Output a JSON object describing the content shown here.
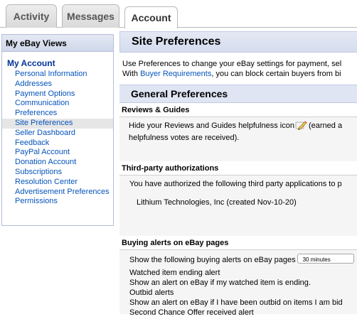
{
  "tabs": [
    {
      "label": "Activity"
    },
    {
      "label": "Messages"
    },
    {
      "label": "Account"
    }
  ],
  "sidebar": {
    "title": "My eBay Views",
    "section": "My Account",
    "items": [
      {
        "label": "Personal Information"
      },
      {
        "label": "Addresses"
      },
      {
        "label": "Payment Options"
      },
      {
        "label": "Communication Preferences"
      },
      {
        "label": "Site Preferences"
      },
      {
        "label": "Seller Dashboard"
      },
      {
        "label": "Feedback"
      },
      {
        "label": "PayPal Account"
      },
      {
        "label": "Donation Account"
      },
      {
        "label": "Subscriptions"
      },
      {
        "label": "Resolution Center"
      },
      {
        "label": "Advertisement Preferences"
      },
      {
        "label": "Permissions"
      }
    ]
  },
  "main": {
    "title": "Site Preferences",
    "intro_line1": "Use Preferences to change your eBay settings for payment, sel",
    "intro_line2_prefix": "With ",
    "intro_link": "Buyer Requirements",
    "intro_line2_suffix": ", you can block certain buyers from bi",
    "general_header": "General Preferences",
    "reviews": {
      "title": "Reviews & Guides",
      "text_before_icon": "Hide your Reviews and Guides helpfulness icon",
      "text_after_icon": "(earned a",
      "line2": "helpfulness votes are received)."
    },
    "third_party": {
      "title": "Third-party authorizations",
      "intro": "You have authorized the following third party applications to p",
      "app": "Lithium Technologies, Inc (created Nov-10-20)"
    },
    "buying_alerts": {
      "title": "Buying alerts on eBay pages",
      "show_label": "Show the following buying alerts on eBay pages",
      "select_value": "30 minutes",
      "lines": [
        "Watched item ending alert",
        "Show an alert on eBay if my watched item is ending.",
        "Outbid alerts",
        "Show an alert on eBay if I have been outbid on items I am bid",
        "Second Chance Offer received alert"
      ]
    }
  },
  "colors": {
    "link": "#0654ba",
    "section_title": "#003399",
    "header_bg": "#dfe5f3"
  },
  "icons": {
    "reviews_icon": "pencil-icon"
  }
}
